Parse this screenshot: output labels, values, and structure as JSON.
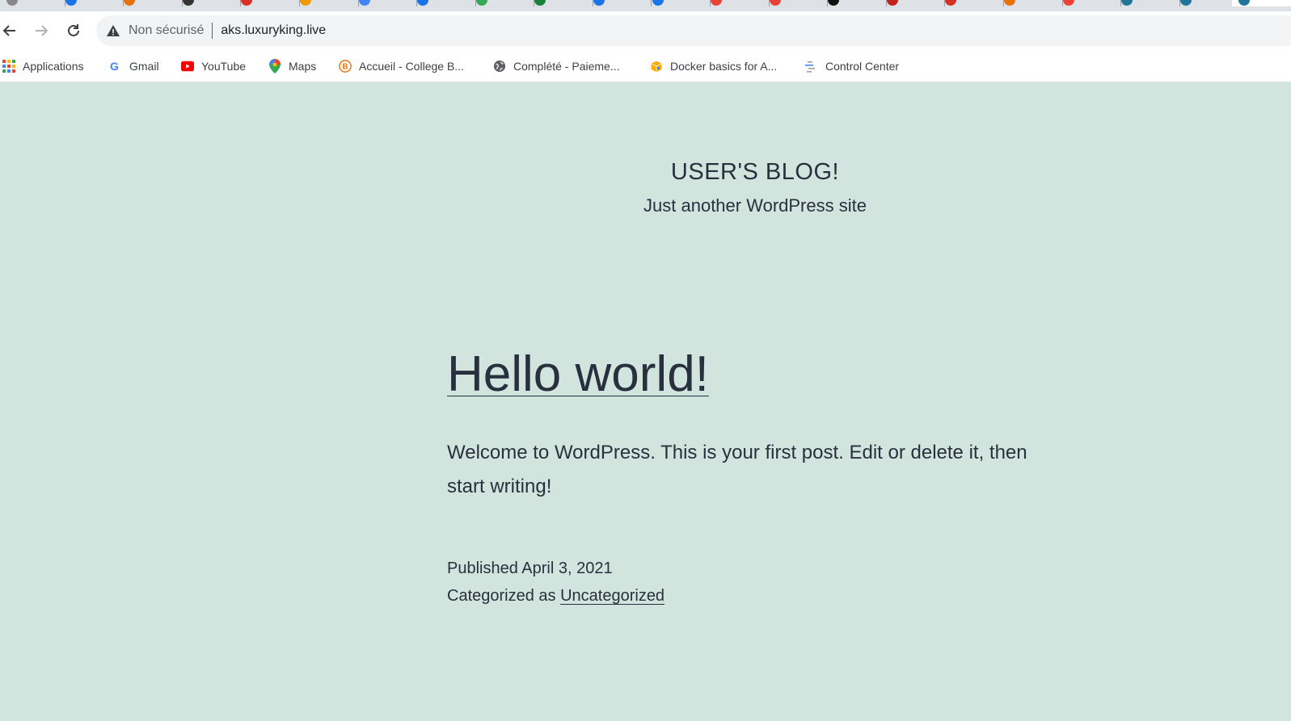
{
  "browser": {
    "address": {
      "security_label": "Non sécurisé",
      "url": "aks.luxuryking.live"
    },
    "bookmarks": [
      {
        "label": "Applications",
        "icon": "apps-grid-icon"
      },
      {
        "label": "Gmail",
        "icon": "google-icon"
      },
      {
        "label": "YouTube",
        "icon": "youtube-icon"
      },
      {
        "label": "Maps",
        "icon": "maps-pin-icon"
      },
      {
        "label": "Accueil - College B...",
        "icon": "college-icon"
      },
      {
        "label": "Complété - Paieme...",
        "icon": "globe-icon"
      },
      {
        "label": "Docker basics for A...",
        "icon": "box-icon"
      },
      {
        "label": "Control Center",
        "icon": "control-center-icon"
      }
    ],
    "tab_colors": [
      "#888888",
      "#1a73e8",
      "#e8710a",
      "#333333",
      "#d93025",
      "#f29900",
      "#4285f4",
      "#1a73e8",
      "#34a853",
      "#188038",
      "#1a73e8",
      "#1a73e8",
      "#ea4335",
      "#ea4335",
      "#111111",
      "#c5221f",
      "#d93025",
      "#e8710a",
      "#ea4335",
      "#21759b",
      "#21759b",
      "#21759b"
    ]
  },
  "site": {
    "title": "USER'S BLOG!",
    "description": "Just another WordPress site",
    "background": "#d1e4dd",
    "text_color": "#28303d"
  },
  "post": {
    "title": "Hello world!",
    "body": "Welcome to WordPress. This is your first post. Edit or delete it, then start writing!",
    "published_label": "Published",
    "published_date": "April 3, 2021",
    "category_label": "Categorized as",
    "category": "Uncategorized"
  }
}
